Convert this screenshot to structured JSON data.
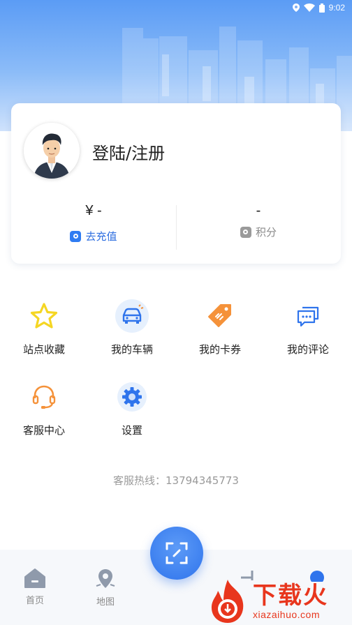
{
  "status_bar": {
    "time": "9:02",
    "icons": [
      "location-icon",
      "wifi-icon",
      "battery-icon"
    ]
  },
  "profile": {
    "login_text": "登陆/注册",
    "balance_value": "¥ -",
    "recharge_label": "去充值",
    "points_value": "-",
    "points_label": "积分"
  },
  "menu": {
    "items": [
      {
        "label": "站点收藏",
        "icon": "star-icon"
      },
      {
        "label": "我的车辆",
        "icon": "car-icon"
      },
      {
        "label": "我的卡券",
        "icon": "coupon-tag-icon"
      },
      {
        "label": "我的评论",
        "icon": "comment-icon"
      },
      {
        "label": "客服中心",
        "icon": "headset-icon"
      },
      {
        "label": "设置",
        "icon": "gear-icon"
      }
    ]
  },
  "hotline": "客服热线：13794345773",
  "bottom_nav": {
    "tabs": [
      {
        "label": "首页",
        "icon": "home-icon"
      },
      {
        "label": "地图",
        "icon": "map-pin-icon"
      }
    ],
    "scan_icon": "scan-icon"
  },
  "watermark": {
    "title": "下载火",
    "subtitle": "xiazaihuo.com"
  },
  "colors": {
    "accent": "#2f74ec",
    "header_gradient_top": "#5b9cf5",
    "star": "#f5d623",
    "coupon": "#f5923a",
    "headset": "#f5923a",
    "watermark": "#e8361d"
  }
}
